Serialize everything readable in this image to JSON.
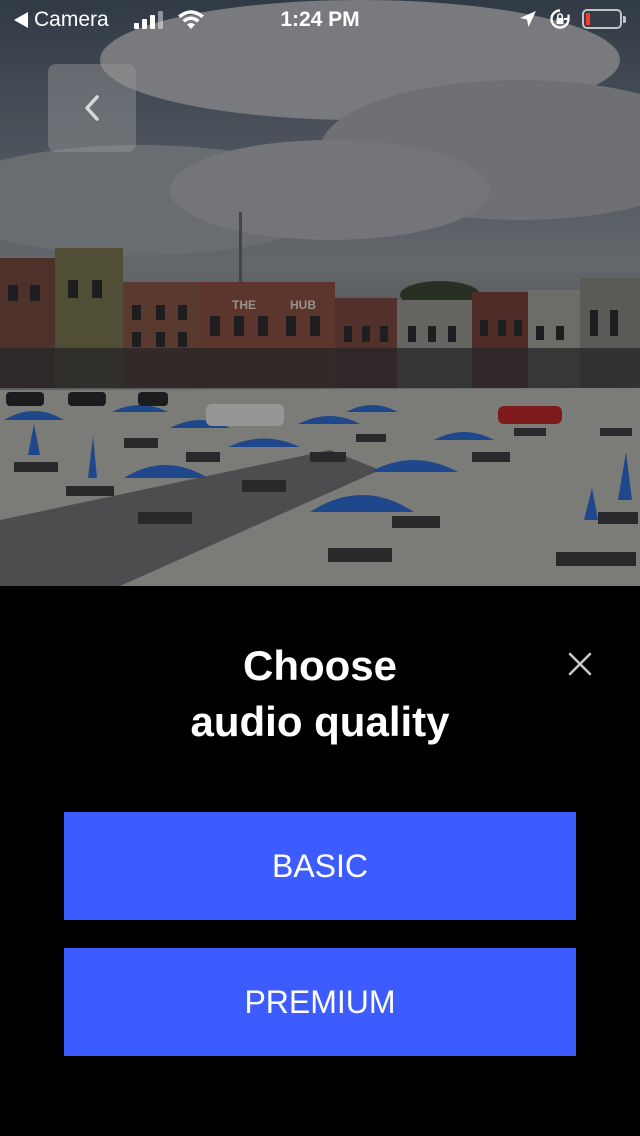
{
  "status_bar": {
    "back_app": "Camera",
    "time": "1:24 PM",
    "signal_icon": "cellular-signal-icon",
    "wifi_icon": "wifi-icon",
    "location_icon": "location-arrow-icon",
    "rotation_lock_icon": "rotation-lock-icon",
    "battery_icon": "battery-low-icon"
  },
  "photo": {
    "storefront_signs": [
      "THE",
      "HUB"
    ]
  },
  "navigation": {
    "back_icon": "chevron-left-icon"
  },
  "sheet": {
    "title_line1": "Choose",
    "title_line2": "audio quality",
    "close_icon": "close-icon",
    "options": [
      "BASIC",
      "PREMIUM"
    ]
  },
  "colors": {
    "accent": "#3d5cff",
    "background": "#000000",
    "battery_low": "#ff3b30"
  }
}
